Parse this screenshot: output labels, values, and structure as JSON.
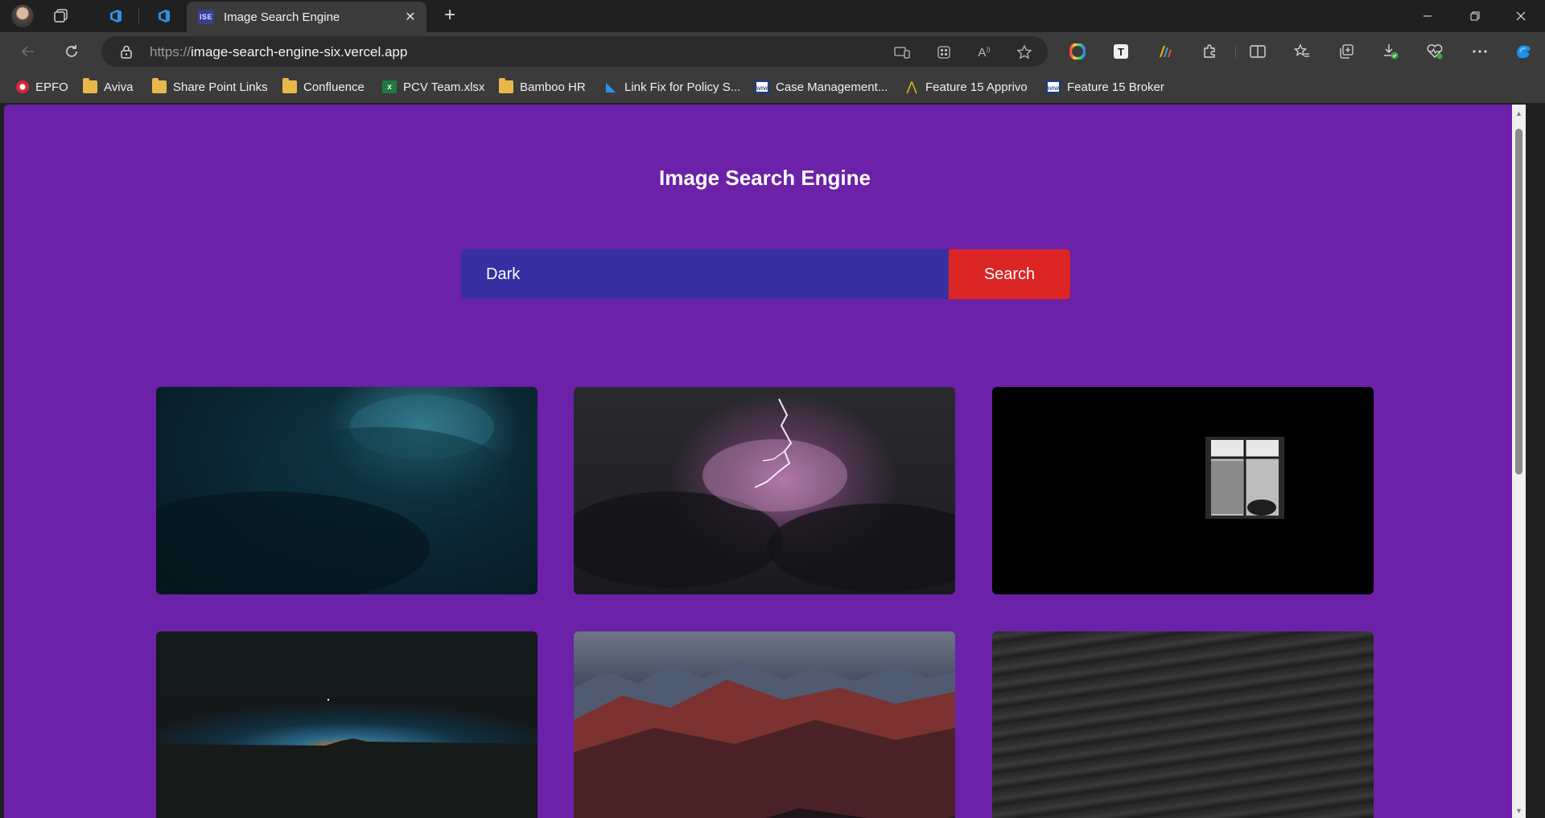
{
  "browser": {
    "active_tab": {
      "favicon_text": "ISE",
      "title": "Image Search Engine"
    },
    "address_bar": {
      "protocol": "https://",
      "host": "image-search-engine-six.vercel.app"
    },
    "bookmarks": [
      {
        "label": "EPFO",
        "icon": "epfo-icon"
      },
      {
        "label": "Aviva",
        "icon": "folder-icon"
      },
      {
        "label": "Share Point Links",
        "icon": "folder-icon"
      },
      {
        "label": "Confluence",
        "icon": "folder-icon"
      },
      {
        "label": "PCV Team.xlsx",
        "icon": "excel-icon"
      },
      {
        "label": "Bamboo HR",
        "icon": "folder-icon"
      },
      {
        "label": "Link Fix for Policy S...",
        "icon": "azure-devops-icon"
      },
      {
        "label": "Case Management...",
        "icon": "aviva-icon"
      },
      {
        "label": "Feature 15 Apprivo",
        "icon": "apprivo-icon"
      },
      {
        "label": "Feature 15 Broker",
        "icon": "aviva-icon"
      }
    ]
  },
  "page": {
    "title": "Image Search Engine",
    "search": {
      "value": "Dark",
      "button_label": "Search"
    },
    "results": [
      {
        "subject": "dark teal storm clouds"
      },
      {
        "subject": "lightning in purple storm clouds"
      },
      {
        "subject": "window in black room"
      },
      {
        "subject": "orange horizon glow at night"
      },
      {
        "subject": "red mountain range at dusk"
      },
      {
        "subject": "dark water waves"
      }
    ]
  },
  "colors": {
    "page_background": "#6b21a8",
    "search_input": "#3730a3",
    "search_button": "#dc2626"
  }
}
